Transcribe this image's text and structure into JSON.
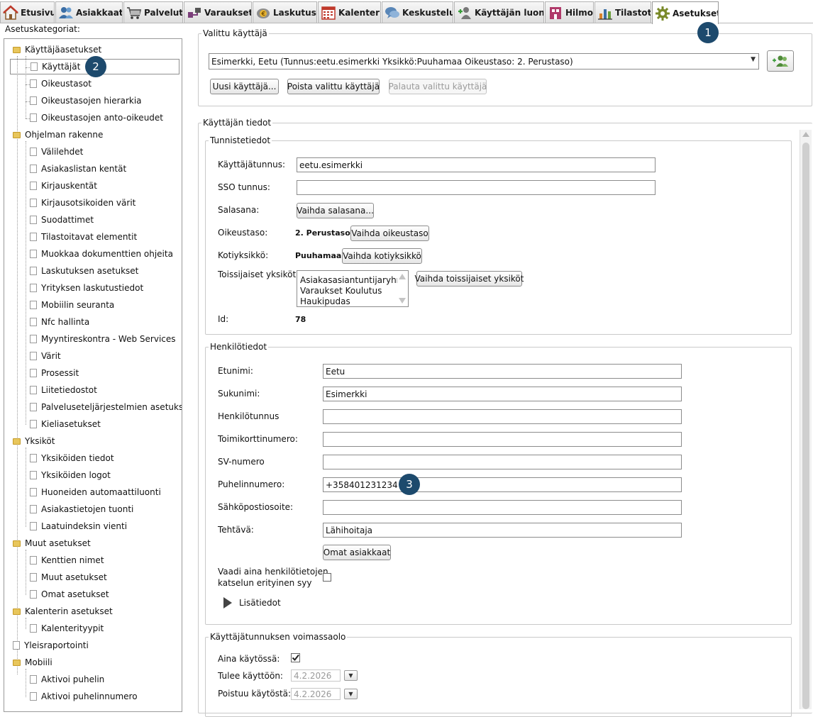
{
  "tabs": [
    {
      "label": "Etusivu",
      "icon": "home-icon",
      "active": false
    },
    {
      "label": "Asiakkaat",
      "icon": "clients-icon",
      "active": false
    },
    {
      "label": "Palvelut",
      "icon": "cart-icon",
      "active": false
    },
    {
      "label": "Varaukset",
      "icon": "reservations-icon",
      "active": false
    },
    {
      "label": "Laskutus",
      "icon": "billing-icon",
      "active": false
    },
    {
      "label": "Kalenteri",
      "icon": "calendar-icon",
      "active": false
    },
    {
      "label": "Keskustelu",
      "icon": "chat-icon",
      "active": false
    },
    {
      "label": "Käyttäjän luonti",
      "icon": "add-user-icon",
      "active": false
    },
    {
      "label": "Hilmo",
      "icon": "hilmo-icon",
      "active": false
    },
    {
      "label": "Tilastot",
      "icon": "stats-icon",
      "active": false
    },
    {
      "label": "Asetukset",
      "icon": "gear-icon",
      "active": true
    }
  ],
  "settings_tree": {
    "caption": "Asetuskategoriat:",
    "groups": [
      {
        "label": "Käyttäjäasetukset",
        "items": [
          "Käyttäjät",
          "Oikeustasot",
          "Oikeustasojen hierarkia",
          "Oikeustasojen anto-oikeudet"
        ]
      },
      {
        "label": "Ohjelman rakenne",
        "items": [
          "Välilehdet",
          "Asiakaslistan kentät",
          "Kirjauskentät",
          "Kirjausotsikoiden värit",
          "Suodattimet",
          "Tilastoitavat elementit",
          "Muokkaa dokumenttien ohjeita",
          "Laskutuksen asetukset",
          "Yrityksen laskutustiedot",
          "Mobiilin seuranta",
          "Nfc hallinta",
          "Myyntireskontra - Web Services",
          "Värit",
          "Prosessit",
          "Liitetiedostot",
          "Palveluseteljärjestelmien asetukset",
          "Kieliasetukset"
        ]
      },
      {
        "label": "Yksiköt",
        "items": [
          "Yksiköiden tiedot",
          "Yksiköiden logot",
          "Huoneiden automaattiluonti",
          "Asiakastietojen tuonti",
          "Laatuindeksin vienti"
        ]
      },
      {
        "label": "Muut asetukset",
        "items": [
          "Kenttien nimet",
          "Muut asetukset",
          "Omat asetukset"
        ]
      },
      {
        "label": "Kalenterin asetukset",
        "items": [
          "Kalenterityypit"
        ]
      },
      {
        "label": "Yleisraportointi",
        "items": []
      },
      {
        "label": "Mobiili",
        "items": [
          "Aktivoi puhelin",
          "Aktivoi puhelinnumero"
        ]
      }
    ],
    "selected": "Käyttäjät"
  },
  "selected_user": {
    "legend": "Valittu käyttäjä",
    "value": "Esimerkki, Eetu (Tunnus:eetu.esimerkki Yksikkö:Puuhamaa Oikeustaso: 2. Perustaso)",
    "new_user_button": "Uusi käyttäjä...",
    "delete_button": "Poista valittu käyttäjä",
    "restore_button": "Palauta valittu käyttäjä"
  },
  "user_info": {
    "legend": "Käyttäjän tiedot",
    "identity": {
      "legend": "Tunnistetiedot",
      "username_label": "Käyttäjätunnus:",
      "username_value": "eetu.esimerkki",
      "sso_label": "SSO tunnus:",
      "sso_value": "",
      "password_label": "Salasana:",
      "password_button": "Vaihda salasana...",
      "access_label": "Oikeustaso:",
      "access_value": "2. Perustaso",
      "access_button": "Vaihda oikeustaso",
      "home_unit_label": "Kotiyksikkö:",
      "home_unit_value": "Puuhamaa",
      "home_unit_button": "Vaihda kotiyksikkö",
      "secondary_label": "Toissijaiset yksiköt:",
      "secondary_units": [
        "Asiakasasiantuntijaryhmä",
        "Varaukset Koulutus",
        "Haukipudas"
      ],
      "secondary_button": "Vaihda toissijaiset yksiköt",
      "id_label": "Id:",
      "id_value": "78"
    },
    "personal": {
      "legend": "Henkilötiedot",
      "first_name_label": "Etunimi:",
      "first_name": "Eetu",
      "last_name_label": "Sukunimi:",
      "last_name": "Esimerkki",
      "ssn_label": "Henkilötunnus",
      "ssn": "",
      "card_label": "Toimikorttinumero:",
      "card": "",
      "sv_label": "SV-numero",
      "sv": "",
      "phone_label": "Puhelinnumero:",
      "phone": "+358401231234",
      "email_label": "Sähköpostiosoite:",
      "email": "",
      "role_label": "Tehtävä:",
      "role": "Lähihoitaja",
      "own_clients_button": "Omat asiakkaat",
      "reason_label_1": "Vaadi aina henkilötietojen",
      "reason_label_2": "katselun erityinen syy",
      "reason_checked": false,
      "more_info": "Lisätiedot"
    },
    "validity": {
      "legend": "Käyttäjätunnuksen voimassaolo",
      "always_label": "Aina käytössä:",
      "always_checked": true,
      "start_label": "Tulee käyttöön:",
      "start_value": "4.2.2026",
      "end_label": "Poistuu käytöstä:",
      "end_value": "4.2.2026"
    }
  },
  "callouts": [
    "1",
    "2",
    "3"
  ],
  "colors": {
    "badge": "#1d4a6d",
    "folder": "#e8c65b"
  }
}
